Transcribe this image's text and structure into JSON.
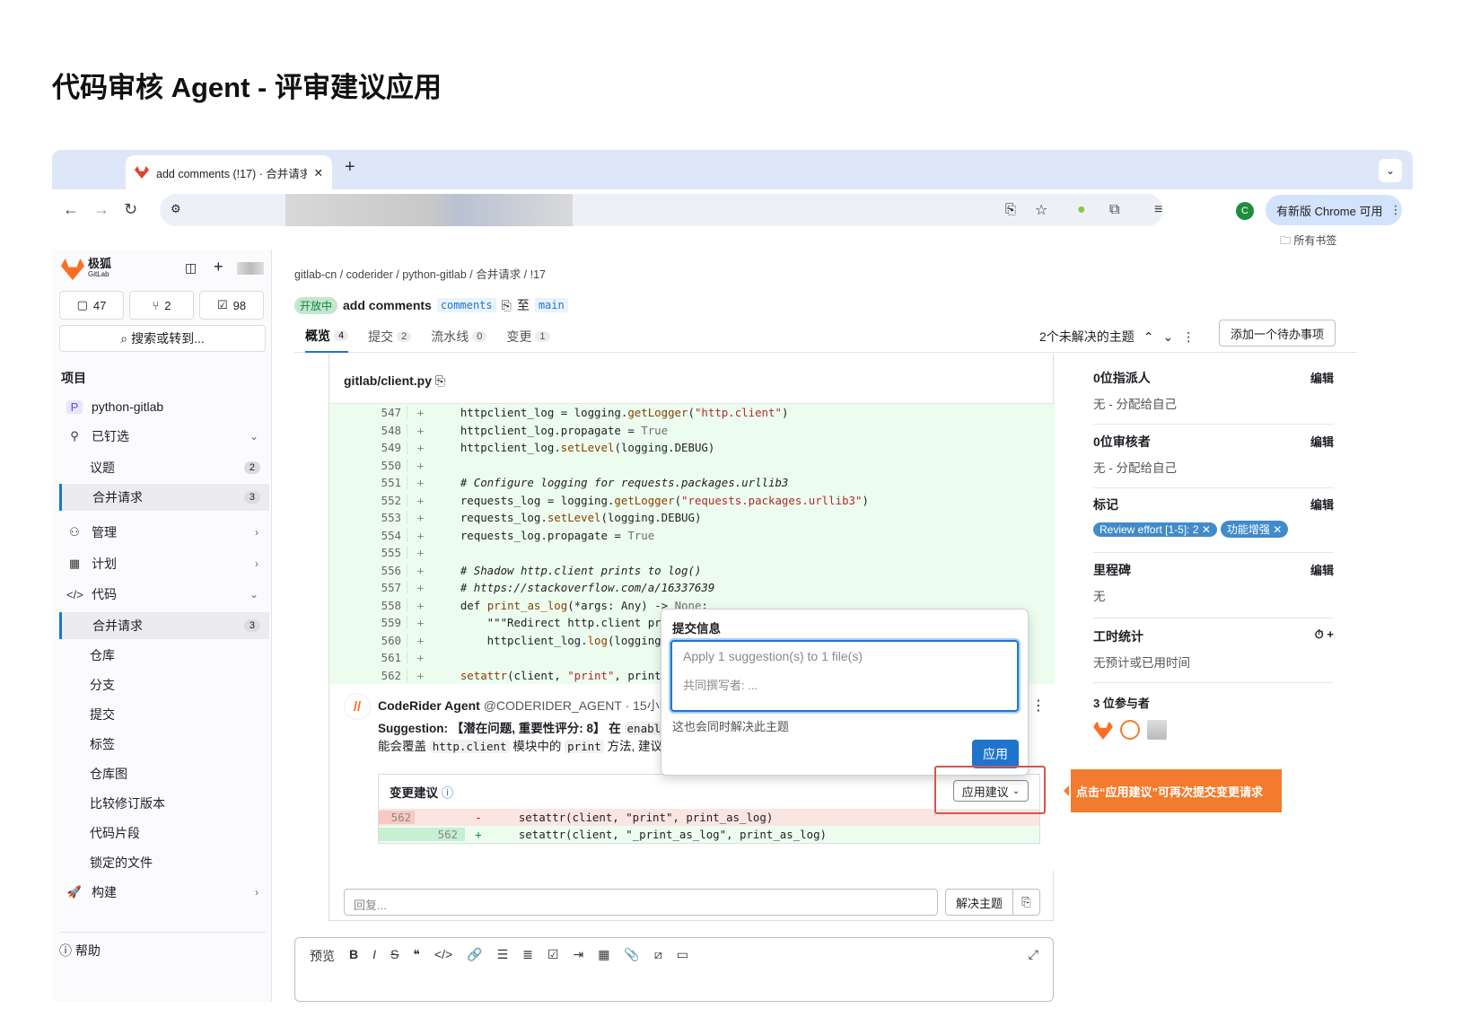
{
  "page_title": "代码审核 Agent - 评审建议应用",
  "browser": {
    "tab_title": "add comments (!17) · 合并请求",
    "update_button": "有新版 Chrome 可用",
    "bookmarks": "所有书签"
  },
  "sidebar": {
    "brand": "极狐",
    "brand_sub": "GitLab",
    "counts": {
      "issues": "47",
      "mrs": "2",
      "todos": "98"
    },
    "search": "搜索或转到...",
    "heading": "项目",
    "project": "python-gitlab",
    "items": [
      {
        "label": "已钉选"
      },
      {
        "label": "议题",
        "badge": "2"
      },
      {
        "label": "合并请求",
        "badge": "3"
      },
      {
        "label": "管理"
      },
      {
        "label": "计划"
      },
      {
        "label": "代码"
      },
      {
        "label": "合并请求",
        "badge": "3"
      },
      {
        "label": "仓库"
      },
      {
        "label": "分支"
      },
      {
        "label": "提交"
      },
      {
        "label": "标签"
      },
      {
        "label": "仓库图"
      },
      {
        "label": "比较修订版本"
      },
      {
        "label": "代码片段"
      },
      {
        "label": "锁定的文件"
      },
      {
        "label": "构建"
      }
    ],
    "help": "帮助"
  },
  "mr": {
    "breadcrumb": "gitlab-cn  /  coderider  /  python-gitlab  /  合并请求  /  !17",
    "status": "开放中",
    "title": "add comments",
    "source_branch": "comments",
    "to": "至",
    "target_branch": "main",
    "tabs": [
      {
        "label": "概览",
        "count": "4"
      },
      {
        "label": "提交",
        "count": "2"
      },
      {
        "label": "流水线",
        "count": "0"
      },
      {
        "label": "变更",
        "count": "1"
      }
    ],
    "unresolved": "2个未解决的主题",
    "add_todo": "添加一个待办事项"
  },
  "file": {
    "path": "gitlab/client.py"
  },
  "comment": {
    "author": "CodeRider Agent",
    "handle": "@CODERIDER_AGENT · 15小时前",
    "text_1": "Suggestion: 【潜在问题, 重要性评分: 8】 在",
    "code_1": "enabl",
    "text_2": "能会覆盖",
    "code_2": "http.client",
    "text_3": "模块中的",
    "code_3": "print",
    "text_4": "方法, 建议",
    "suggest_heading": "变更建议",
    "apply_suggestion": "应用建议",
    "old_line_no": "562",
    "old_line": "setattr(client, \"print\", print_as_log)",
    "new_line_no": "562",
    "new_line": "setattr(client, \"_print_as_log\", print_as_log)",
    "reply_placeholder": "回复...",
    "resolve": "解决主题"
  },
  "popover": {
    "title": "提交信息",
    "placeholder_1": "Apply 1 suggestion(s) to 1 file(s)",
    "placeholder_2": "共同撰写者: ...",
    "note": "这也会同时解决此主题",
    "apply": "应用"
  },
  "callout": "点击“应用建议”可再次提交变更请求",
  "editor": {
    "preview": "预览"
  },
  "right": {
    "assignee_h": "0位指派人",
    "assignee_v": "无 - 分配给自己",
    "reviewer_h": "0位审核者",
    "reviewer_v": "无 - 分配给自己",
    "labels_h": "标记",
    "label_1": "Review effort [1-5]: 2",
    "label_2": "功能增强",
    "milestone_h": "里程碑",
    "milestone_v": "无",
    "time_h": "工时统计",
    "time_v": "无预计或已用时间",
    "participants_h": "3 位参与者",
    "edit": "编辑"
  },
  "colors": {
    "accent": "#1f75cb",
    "diff_add": "#ecfdf0",
    "diff_del": "#fbe5e1",
    "callout": "#f37b2e"
  }
}
